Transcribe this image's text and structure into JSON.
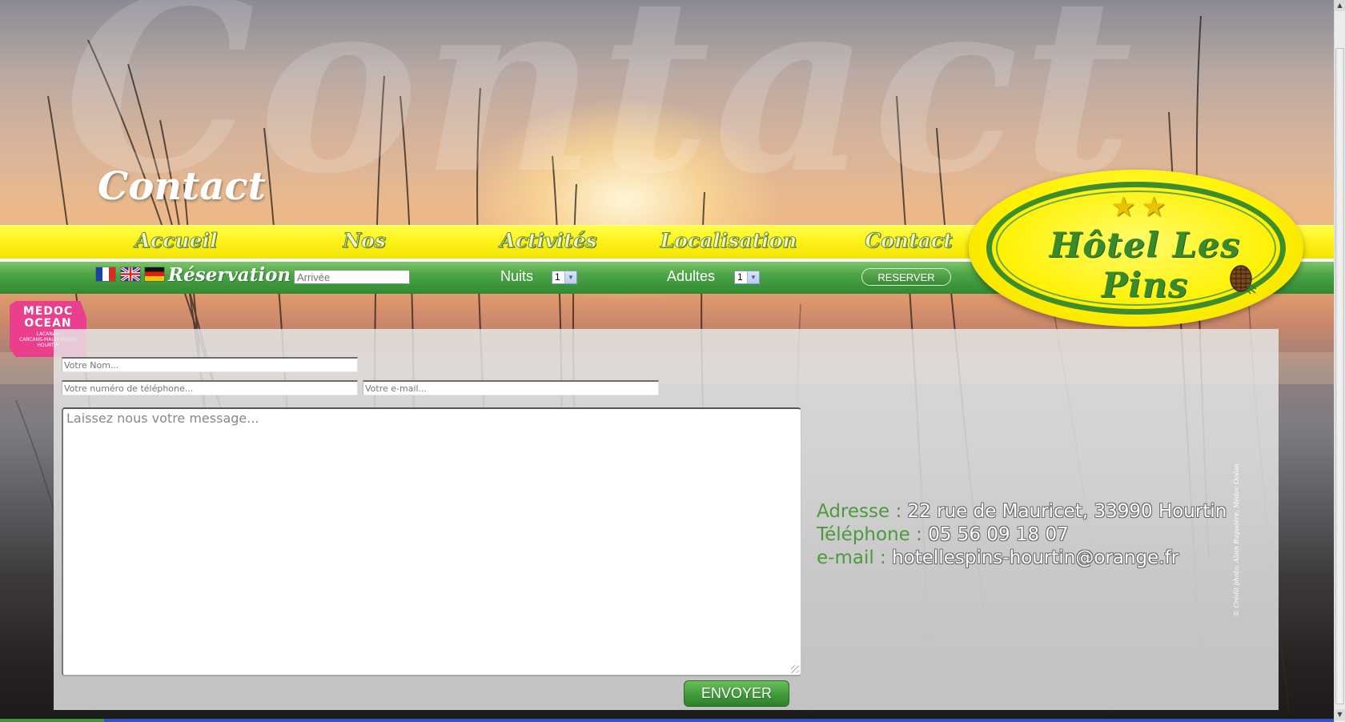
{
  "header": {
    "watermark": "Contact",
    "page_title": "Contact"
  },
  "nav": {
    "items": [
      {
        "label": "Accueil"
      },
      {
        "label": "Nos Chambres"
      },
      {
        "label": "Activités"
      },
      {
        "label": "Localisation"
      },
      {
        "label": "Contact"
      }
    ]
  },
  "reservation": {
    "languages": [
      "fr-flag-icon",
      "uk-flag-icon",
      "de-flag-icon"
    ],
    "label": "Réservation",
    "arrival_placeholder": "Arrivée",
    "nights_label": "Nuits",
    "nights_value": "1",
    "adults_label": "Adultes",
    "adults_value": "1",
    "reserve_button": "RESERVER"
  },
  "logo": {
    "name": "Hôtel Les Pins",
    "stars": 2
  },
  "badge": {
    "line1": "MEDOC",
    "line2": "OCEAN",
    "line3": "LACANAU",
    "line4": "CARCANS-MAUBUISSON",
    "line5": "HOURTIN"
  },
  "form": {
    "name_placeholder": "Votre Nom...",
    "phone_placeholder": "Votre numéro de téléphone...",
    "email_placeholder": "Votre e-mail...",
    "message_placeholder": "Laissez nous votre message...",
    "send_button": "ENVOYER"
  },
  "contact_info": {
    "address_label": "Adresse :",
    "address_value": "22 rue de Mauricet, 33990 Hourtin",
    "phone_label": "Téléphone :",
    "phone_value": "05 56 09 18 07",
    "email_label": "e-mail :",
    "email_value": "hotellespins-hourtin@orange.fr"
  },
  "photo_credit": "© Crédit photo: Alain Ruyssière, Médoc Océan",
  "colors": {
    "nav_yellow": "#fff21a",
    "band_green": "#4da448",
    "label_green": "#4d9a3d",
    "badge_pink": "#ea3f8c"
  }
}
